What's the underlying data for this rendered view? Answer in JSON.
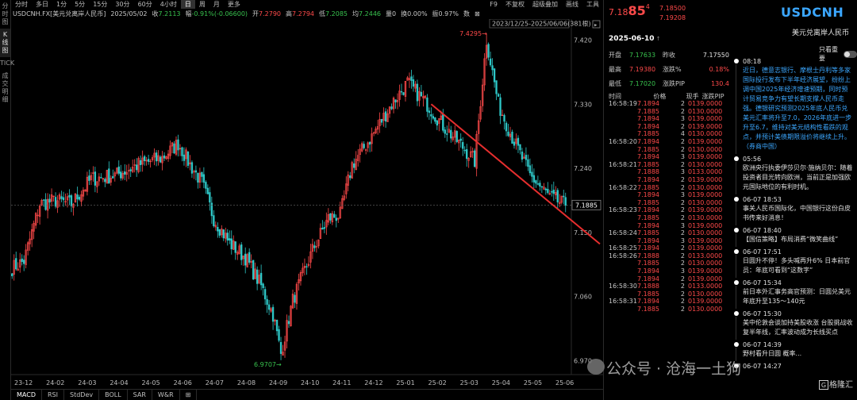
{
  "sidebar": {
    "items": [
      "分时图",
      "K线图",
      "TICK",
      "成交明细"
    ],
    "active_index": 1
  },
  "toptabs": {
    "items": [
      "分时",
      "多日",
      "1分",
      "5分",
      "15分",
      "30分",
      "60分",
      "4小时",
      "日",
      "周",
      "月",
      "更多"
    ],
    "active_index": 8,
    "right_items": [
      "F9",
      "不复权",
      "超级叠加",
      "画线",
      "工具"
    ]
  },
  "infobar": {
    "symbol": "USDCNH.FX[美元兑离岸人民币]",
    "date": "2025/05/02",
    "close_label": "收",
    "close": "7.2113",
    "change_label": "幅",
    "change": "-0.91%(-0.06600)",
    "open_label": "开",
    "open": "7.2790",
    "high_label": "高",
    "high": "7.2794",
    "low_label": "低",
    "low": "7.2085",
    "avg_label": "均",
    "avg": "7.2446",
    "volume_label": "量",
    "volume": "0",
    "turnover_label": "换",
    "turnover": "0.00%",
    "amplitude_label": "振",
    "amplitude": "0.97%",
    "extra": "数"
  },
  "range_label": "2023/12/25-2025/06/06(381根)",
  "chart_data": {
    "type": "candlestick",
    "x_ticks": [
      "23-12",
      "24-02",
      "24-03",
      "24-04",
      "24-05",
      "24-06",
      "24-07",
      "24-08",
      "24-09",
      "24-10",
      "24-11",
      "24-12",
      "25-01",
      "25-02",
      "25-03",
      "25-04",
      "25-05",
      "25-06"
    ],
    "y_ticks": [
      "7.420",
      "7.330",
      "7.240",
      "7.150",
      "7.060",
      "6.970"
    ],
    "ylim": [
      6.955,
      7.445
    ],
    "last_price": "7.1885",
    "high_marker": "7.4295",
    "low_marker": "6.9707",
    "trendline": {
      "from": {
        "x": "25-01",
        "y": 7.33
      },
      "to": {
        "x": "25-06",
        "y": 7.145
      },
      "color": "#e62e2e"
    },
    "anchors": [
      [
        0,
        7.1
      ],
      [
        6,
        7.11
      ],
      [
        14,
        7.19
      ],
      [
        22,
        7.195
      ],
      [
        30,
        7.19
      ],
      [
        40,
        7.225
      ],
      [
        52,
        7.23
      ],
      [
        64,
        7.245
      ],
      [
        76,
        7.255
      ],
      [
        84,
        7.275
      ],
      [
        90,
        7.245
      ],
      [
        96,
        7.22
      ],
      [
        102,
        7.17
      ],
      [
        110,
        7.135
      ],
      [
        118,
        7.115
      ],
      [
        126,
        7.075
      ],
      [
        132,
        7.035
      ],
      [
        136,
        6.98
      ],
      [
        142,
        7.055
      ],
      [
        152,
        7.125
      ],
      [
        160,
        7.17
      ],
      [
        166,
        7.175
      ],
      [
        172,
        7.245
      ],
      [
        182,
        7.285
      ],
      [
        192,
        7.33
      ],
      [
        200,
        7.36
      ],
      [
        210,
        7.33
      ],
      [
        218,
        7.3
      ],
      [
        228,
        7.27
      ],
      [
        234,
        7.25
      ],
      [
        240,
        7.42
      ],
      [
        246,
        7.33
      ],
      [
        252,
        7.29
      ],
      [
        262,
        7.23
      ],
      [
        272,
        7.2
      ],
      [
        280,
        7.188
      ]
    ],
    "high_index": 240,
    "low_index": 136,
    "colors": {
      "up": "#ff4a4a",
      "down": "#2ec8c8"
    }
  },
  "bottomtabs": {
    "items": [
      "MACD",
      "RSI",
      "StdDev",
      "BOLL",
      "SAR",
      "W&R",
      "⊞"
    ],
    "active_index": 0
  },
  "quote": {
    "big_price_a": "7.18",
    "big_price_b": "85",
    "big_price_c": "4",
    "ask": "7.18500",
    "bid": "7.19208",
    "date": "2025-06-10",
    "stats": [
      {
        "label": "开盘",
        "value": "7.17633",
        "value_color": "#38c24e",
        "label2": "昨收",
        "value2": "7.17550",
        "value2_color": "#e0e0e0"
      },
      {
        "label": "最高",
        "value": "7.19380",
        "value_color": "#ff4a4a",
        "label2": "涨跌%",
        "value2": "0.18%",
        "value2_color": "#ff4a4a"
      },
      {
        "label": "最低",
        "value": "7.17020",
        "value_color": "#38c24e",
        "label2": "涨跌PIP",
        "value2": "130.4",
        "value2_color": "#ff4a4a"
      }
    ],
    "tick_header": [
      "时间",
      "价格",
      "现手",
      "涨跌PIP"
    ],
    "ticks": [
      [
        "16:58:19",
        "7.1894",
        "2",
        "0139.0000"
      ],
      [
        "",
        "7.1885",
        "2",
        "0130.0000"
      ],
      [
        "",
        "7.1894",
        "3",
        "0139.0000"
      ],
      [
        "",
        "7.1894",
        "2",
        "0139.0000"
      ],
      [
        "",
        "7.1885",
        "4",
        "0130.0000"
      ],
      [
        "16:58:20",
        "7.1894",
        "2",
        "0139.0000"
      ],
      [
        "",
        "7.1885",
        "2",
        "0130.0000"
      ],
      [
        "",
        "7.1894",
        "3",
        "0139.0000"
      ],
      [
        "16:58:21",
        "7.1885",
        "2",
        "0130.0000"
      ],
      [
        "",
        "7.1888",
        "3",
        "0133.0000"
      ],
      [
        "",
        "7.1894",
        "2",
        "0139.0000"
      ],
      [
        "16:58:22",
        "7.1885",
        "2",
        "0130.0000"
      ],
      [
        "",
        "7.1894",
        "3",
        "0139.0000"
      ],
      [
        "",
        "7.1885",
        "2",
        "0130.0000"
      ],
      [
        "16:58:23",
        "7.1894",
        "2",
        "0139.0000"
      ],
      [
        "",
        "7.1885",
        "2",
        "0130.0000"
      ],
      [
        "",
        "7.1894",
        "3",
        "0139.0000"
      ],
      [
        "16:58:24",
        "7.1885",
        "2",
        "0130.0000"
      ],
      [
        "",
        "7.1894",
        "3",
        "0139.0000"
      ],
      [
        "16:58:25",
        "7.1894",
        "2",
        "0139.0000"
      ],
      [
        "16:58:26",
        "7.1888",
        "2",
        "0133.0000"
      ],
      [
        "",
        "7.1885",
        "2",
        "0130.0000"
      ],
      [
        "",
        "7.1894",
        "3",
        "0139.0000"
      ],
      [
        "",
        "7.1894",
        "2",
        "0139.0000"
      ],
      [
        "16:58:30",
        "7.1888",
        "2",
        "0133.0000"
      ],
      [
        "",
        "7.1885",
        "2",
        "0130.0000"
      ],
      [
        "16:58:31",
        "7.1894",
        "2",
        "0139.0000"
      ],
      [
        "",
        "7.1885",
        "2",
        "0130.0000"
      ]
    ]
  },
  "news": {
    "symbol": "USDCNH",
    "symbol_name": "美元兑离岸人民币",
    "toggle_label": "只看重要",
    "items": [
      {
        "time": "08:18",
        "text": "近日，德意志银行、摩根士丹利等多家国际投行发布下半年经济展望，纷纷上调中国2025年经济增速预期，同时预计贸易竞争力有望长期支撑人民币走强。德银研究预测2025年底人民币兑美元汇率将升至7.0，2026年底进一步升至6.7，维持对美元结构性看跌的观点，并预计美债期限溢价将继续上升。（券商中国）",
        "blue": true
      },
      {
        "time": "05:56",
        "text": "欧洲央行执委伊莎贝尔·施纳贝尔：随着投资者目光转向欧洲，当前正是加强欧元国际地位的有利时机。",
        "blue": false
      },
      {
        "time": "06-07 18:53",
        "text": "事关人民币国际化，中国银行这份白皮书传来好消息！",
        "blue": false
      },
      {
        "time": "06-07 18:40",
        "text": "【国信策略】布局消费“微笑曲线”",
        "blue": false
      },
      {
        "time": "06-07 17:51",
        "text": "日圆升不停！多头喊再升6% 日本前官员：年底可看到“这数字”",
        "blue": false
      },
      {
        "time": "06-07 15:34",
        "text": "前日本外汇事务高官预测：日圆兑美元年底升至135～140元",
        "blue": false
      },
      {
        "time": "06-07 15:30",
        "text": "美中伦敦会谈加持美股收涨 台股挑战收复半年线，汇率波动成为长线买点",
        "blue": false
      },
      {
        "time": "06-07 14:39",
        "text": "野村看升日圆 概率...",
        "blue": false
      },
      {
        "time": "06-07 14:27",
        "text": "",
        "blue": false
      }
    ]
  },
  "watermark": {
    "text": "公众号 · 沧海一土狗"
  },
  "brand": {
    "text": "格隆汇"
  }
}
